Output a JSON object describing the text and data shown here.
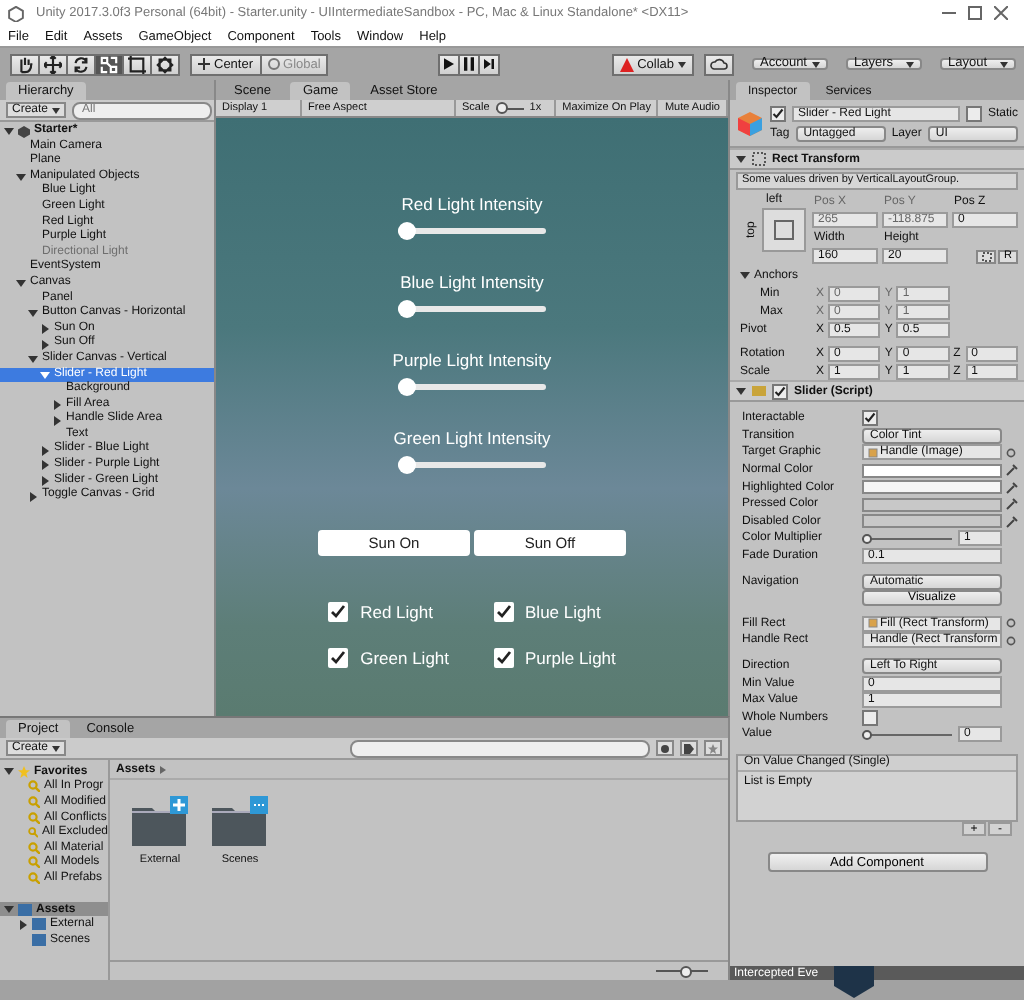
{
  "window": {
    "title": "Unity 2017.3.0f3 Personal (64bit) - Starter.unity - UIIntermediateSandbox - PC, Mac & Linux Standalone* <DX11>"
  },
  "menu": [
    "File",
    "Edit",
    "Assets",
    "GameObject",
    "Component",
    "Tools",
    "Window",
    "Help"
  ],
  "toolbar": {
    "tools": [
      {
        "kind": "hand",
        "selected": false
      },
      {
        "kind": "move",
        "selected": false
      },
      {
        "kind": "rotate",
        "selected": false
      },
      {
        "kind": "scale",
        "selected": true
      },
      {
        "kind": "rect",
        "selected": false
      },
      {
        "kind": "transform",
        "selected": false
      }
    ],
    "pivot": "Center",
    "space": "Global",
    "space_disabled": true,
    "collab": "Collab",
    "account": "Account",
    "layers": "Layers",
    "layout": "Layout"
  },
  "hierarchy": {
    "tab": "Hierarchy",
    "create": "Create",
    "search_placeholder": "All",
    "scene": {
      "label": "Starter*",
      "expanded": true,
      "children": [
        {
          "label": "Main Camera",
          "selected": false,
          "disabled": false
        },
        {
          "label": "Plane",
          "selected": false,
          "disabled": false
        },
        {
          "label": "Manipulated Objects",
          "expanded": true,
          "selected": false,
          "disabled": false,
          "children": [
            {
              "label": "Blue Light",
              "selected": false,
              "disabled": false
            },
            {
              "label": "Green Light",
              "selected": false,
              "disabled": false
            },
            {
              "label": "Red Light",
              "selected": false,
              "disabled": false
            },
            {
              "label": "Purple Light",
              "selected": false,
              "disabled": false
            },
            {
              "label": "Directional Light",
              "selected": false,
              "disabled": true
            }
          ]
        },
        {
          "label": "EventSystem",
          "selected": false,
          "disabled": false
        },
        {
          "label": "Canvas",
          "expanded": true,
          "selected": false,
          "disabled": false,
          "children": [
            {
              "label": "Panel",
              "selected": false,
              "disabled": false
            },
            {
              "label": "Button Canvas - Horizontal",
              "expanded": true,
              "selected": false,
              "disabled": false,
              "children": [
                {
                  "label": "Sun On",
                  "expanded": false,
                  "selected": false,
                  "disabled": false
                },
                {
                  "label": "Sun Off",
                  "expanded": false,
                  "selected": false,
                  "disabled": false
                }
              ]
            },
            {
              "label": "Slider Canvas - Vertical",
              "expanded": true,
              "selected": false,
              "disabled": false,
              "children": [
                {
                  "label": "Slider - Red Light",
                  "expanded": true,
                  "selected": true,
                  "disabled": false,
                  "children": [
                    {
                      "label": "Background",
                      "selected": false,
                      "disabled": false
                    },
                    {
                      "label": "Fill Area",
                      "expanded": false,
                      "selected": false,
                      "disabled": false
                    },
                    {
                      "label": "Handle Slide Area",
                      "expanded": false,
                      "selected": false,
                      "disabled": false
                    },
                    {
                      "label": "Text",
                      "selected": false,
                      "disabled": false
                    }
                  ]
                },
                {
                  "label": "Slider - Blue Light",
                  "expanded": false,
                  "selected": false,
                  "disabled": false
                },
                {
                  "label": "Slider - Purple Light",
                  "expanded": false,
                  "selected": false,
                  "disabled": false
                },
                {
                  "label": "Slider - Green Light",
                  "expanded": false,
                  "selected": false,
                  "disabled": false
                }
              ]
            },
            {
              "label": "Toggle Canvas - Grid",
              "expanded": false,
              "selected": false,
              "disabled": false
            }
          ]
        }
      ]
    }
  },
  "game": {
    "tabs": [
      {
        "label": "Scene",
        "selected": false
      },
      {
        "label": "Game",
        "selected": true
      },
      {
        "label": "Asset Store",
        "selected": false
      }
    ],
    "display": "Display 1",
    "aspect": "Free Aspect",
    "scale_label": "Scale",
    "scale_slider": {
      "level": 0
    },
    "scale_value": "1x",
    "maximize": "Maximize On Play",
    "mute": "Mute Audio",
    "sliders": [
      {
        "label": "Red Light Intensity",
        "level": 0
      },
      {
        "label": "Blue Light Intensity",
        "level": 0
      },
      {
        "label": "Purple Light Intensity",
        "level": 0
      },
      {
        "label": "Green Light Intensity",
        "level": 0
      }
    ],
    "buttons": [
      "Sun On",
      "Sun Off"
    ],
    "toggles": [
      {
        "label": "Red Light",
        "checked": true
      },
      {
        "label": "Blue Light",
        "checked": true
      },
      {
        "label": "Green Light",
        "checked": true
      },
      {
        "label": "Purple Light",
        "checked": true
      }
    ]
  },
  "inspector": {
    "tabs": [
      {
        "label": "Inspector",
        "selected": true
      },
      {
        "label": "Services",
        "selected": false
      }
    ],
    "object": {
      "active": true,
      "name": "Slider - Red Light",
      "static_label": "Static",
      "static": false,
      "tag_label": "Tag",
      "tag": "Untagged",
      "layer_label": "Layer",
      "layer": "UI"
    },
    "rect_transform": {
      "title": "Rect Transform",
      "note": "Some values driven by VerticalLayoutGroup.",
      "anchor_h": "left",
      "anchor_v": "top",
      "pos_fields": [
        {
          "label": "Pos X",
          "value": "265",
          "disabled": true
        },
        {
          "label": "Pos Y",
          "value": "-118.875",
          "disabled": true
        },
        {
          "label": "Pos Z",
          "value": "0",
          "disabled": false
        }
      ],
      "size_fields": [
        {
          "label": "Width",
          "value": "160",
          "disabled": false
        },
        {
          "label": "Height",
          "value": "20",
          "disabled": false
        }
      ],
      "raw_button": "R",
      "anchors_label": "Anchors",
      "anchors_expanded": true,
      "anchor_rows": [
        {
          "label": "Min",
          "fields": [
            {
              "axis": "X",
              "value": "0",
              "disabled": true
            },
            {
              "axis": "Y",
              "value": "1",
              "disabled": true
            }
          ]
        },
        {
          "label": "Max",
          "fields": [
            {
              "axis": "X",
              "value": "0",
              "disabled": true
            },
            {
              "axis": "Y",
              "value": "1",
              "disabled": true
            }
          ]
        }
      ],
      "vectors": [
        {
          "label": "Pivot",
          "fields": [
            {
              "axis": "X",
              "value": "0.5",
              "disabled": false
            },
            {
              "axis": "Y",
              "value": "0.5",
              "disabled": false
            }
          ]
        },
        {
          "label": "Rotation",
          "fields": [
            {
              "axis": "X",
              "value": "0",
              "disabled": false
            },
            {
              "axis": "Y",
              "value": "0",
              "disabled": false
            },
            {
              "axis": "Z",
              "value": "0",
              "disabled": false
            }
          ]
        },
        {
          "label": "Scale",
          "fields": [
            {
              "axis": "X",
              "value": "1",
              "disabled": false
            },
            {
              "axis": "Y",
              "value": "1",
              "disabled": false
            },
            {
              "axis": "Z",
              "value": "1",
              "disabled": false
            }
          ]
        }
      ]
    },
    "slider": {
      "title": "Slider (Script)",
      "enabled": true,
      "groups": [
        [
          {
            "kind": "checkbox",
            "label": "Interactable",
            "checked": true
          },
          {
            "kind": "dropdown",
            "label": "Transition",
            "value": "Color Tint"
          },
          {
            "kind": "object",
            "label": "Target Graphic",
            "value": "Handle (Image)"
          },
          {
            "kind": "color",
            "label": "Normal Color",
            "color": "#ffffff"
          },
          {
            "kind": "color",
            "label": "Highlighted Color",
            "color": "#f5f5f5"
          },
          {
            "kind": "color",
            "label": "Pressed Color",
            "color": "#c8c8c8"
          },
          {
            "kind": "color",
            "label": "Disabled Color",
            "color": "#c8c8c8"
          },
          {
            "kind": "slider",
            "label": "Color Multiplier",
            "level": 0,
            "value": "1"
          },
          {
            "kind": "text",
            "label": "Fade Duration",
            "value": "0.1"
          }
        ],
        [
          {
            "kind": "dropdown",
            "label": "Navigation",
            "value": "Automatic"
          },
          {
            "kind": "button",
            "text": "Visualize"
          }
        ],
        [
          {
            "kind": "object",
            "label": "Fill Rect",
            "value": "Fill (Rect Transform)"
          },
          {
            "kind": "object",
            "label": "Handle Rect",
            "value": "Handle (Rect Transform"
          }
        ],
        [
          {
            "kind": "dropdown",
            "label": "Direction",
            "value": "Left To Right"
          },
          {
            "kind": "text",
            "label": "Min Value",
            "value": "0"
          },
          {
            "kind": "text",
            "label": "Max Value",
            "value": "1"
          },
          {
            "kind": "checkbox",
            "label": "Whole Numbers",
            "checked": false
          },
          {
            "kind": "slider",
            "label": "Value",
            "level": 0,
            "value": "0"
          }
        ]
      ],
      "event": {
        "title": "On Value Changed (Single)",
        "empty_text": "List is Empty",
        "add": "+",
        "remove": "-"
      }
    },
    "add_component": "Add Component",
    "intercepted": "Intercepted Eve"
  },
  "project": {
    "tabs": [
      {
        "label": "Project",
        "selected": true
      },
      {
        "label": "Console",
        "selected": false
      }
    ],
    "create": "Create",
    "favorites": {
      "label": "Favorites",
      "expanded": true,
      "items": [
        "All In Progr",
        "All Modified",
        "All Conflicts",
        "All Excluded",
        "All Material",
        "All Models",
        "All Prefabs"
      ]
    },
    "assets": {
      "label": "Assets",
      "expanded": true,
      "selected": true,
      "children": [
        {
          "label": "External",
          "expanded": false,
          "selected": false
        },
        {
          "label": "Scenes",
          "selected": false
        }
      ]
    },
    "breadcrumb": "Assets",
    "folders": [
      {
        "name": "External",
        "kind": "plus"
      },
      {
        "name": "Scenes",
        "kind": "more"
      }
    ],
    "zoom_slider": {
      "level": 0.6
    }
  }
}
